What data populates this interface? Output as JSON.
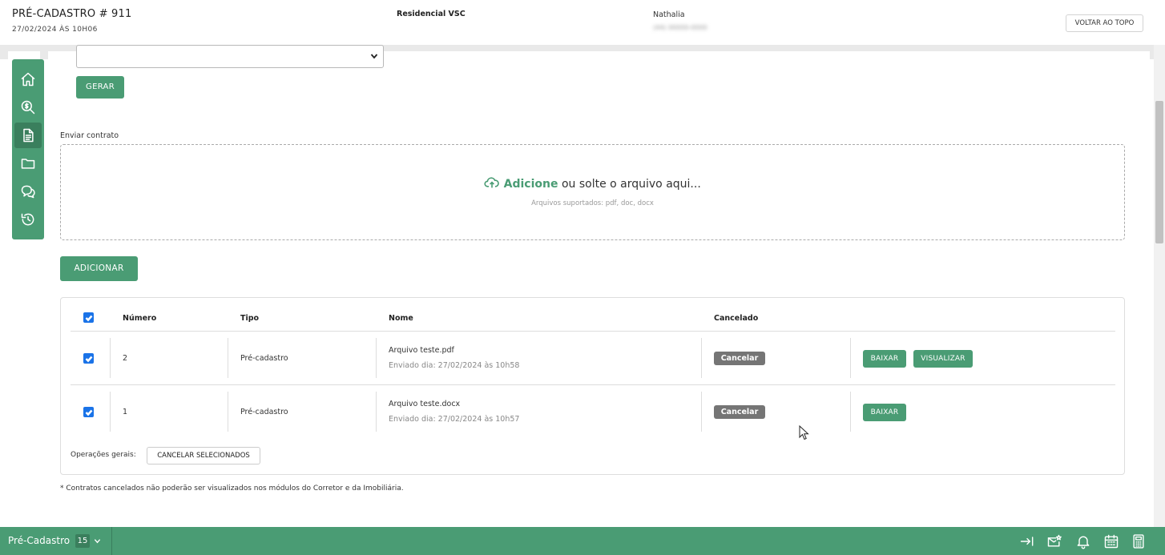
{
  "header": {
    "title": "PRÉ-CADASTRO # 911",
    "datetime": "27/02/2024 ÀS 10H06",
    "project": "Residencial VSC",
    "user_name": "Nathalia",
    "user_phone": "(44) 00000-0000",
    "back_to_top_label": "VOLTAR AO TOPO"
  },
  "sidebar": {
    "items": [
      {
        "icon": "home-icon"
      },
      {
        "icon": "search-money-icon"
      },
      {
        "icon": "document-icon",
        "active": true
      },
      {
        "icon": "folder-icon"
      },
      {
        "icon": "chat-icon"
      },
      {
        "icon": "history-icon"
      }
    ]
  },
  "form": {
    "select_value": "",
    "generate_label": "GERAR",
    "send_contract_label": "Enviar contrato",
    "dropzone": {
      "action": "Adicione",
      "text": "ou solte o arquivo aqui...",
      "supported": "Arquivos suportados: pdf, doc, docx"
    },
    "add_label": "ADICIONAR"
  },
  "table": {
    "headers": {
      "number": "Número",
      "type": "Tipo",
      "name": "Nome",
      "cancelled": "Cancelado"
    },
    "rows": [
      {
        "checked": true,
        "number": "2",
        "type": "Pré-cadastro",
        "file": "Arquivo teste.pdf",
        "sent": "Enviado dia: 27/02/2024 às 10h58",
        "cancel_label": "Cancelar",
        "download_label": "BAIXAR",
        "view_label": "VISUALIZAR"
      },
      {
        "checked": true,
        "number": "1",
        "type": "Pré-cadastro",
        "file": "Arquivo teste.docx",
        "sent": "Enviado dia: 27/02/2024 às 10h57",
        "cancel_label": "Cancelar",
        "download_label": "BAIXAR"
      }
    ],
    "ops_label": "Operações gerais:",
    "cancel_selected_label": "CANCELAR SELECIONADOS"
  },
  "footnote": "* Contratos cancelados não poderão ser visualizados nos módulos do Corretor e da Imobiliária.",
  "bottom_bar": {
    "module": "Pré-Cadastro",
    "count": "15",
    "icons": [
      "login-arrow-icon",
      "mail-star-icon",
      "bell-icon",
      "calendar-icon",
      "calculator-icon"
    ]
  },
  "colors": {
    "accent": "#4a9c74",
    "accent_dark": "#3a7f5d",
    "cancel_gray": "#757575",
    "checkbox": "#1a73e8"
  }
}
